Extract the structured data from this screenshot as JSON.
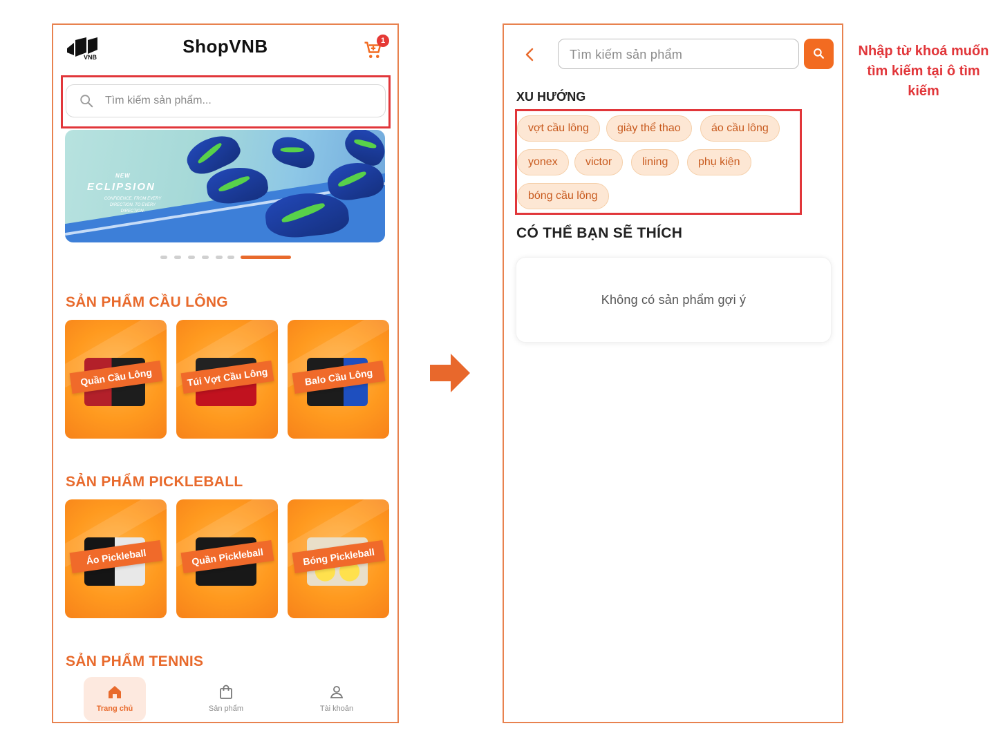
{
  "left_screen": {
    "app_title": "ShopVNB",
    "logo_text": "VNB",
    "cart_count": "1",
    "search_placeholder": "Tìm kiếm sản phẩm...",
    "banner": {
      "small_text": "NEW",
      "brand": "ECLIPSION",
      "tagline": "CONFIDENCE. FROM EVERY DIRECTION. TO EVERY DIRECTION.",
      "slide_count": 7,
      "active_slide": 7
    },
    "sections": [
      {
        "title": "SẢN PHẨM CẦU LÔNG",
        "cards": [
          "Quần Cầu Lông",
          "Túi Vợt Cầu Lông",
          "Balo Cầu Lông"
        ]
      },
      {
        "title": "SẢN PHẨM PICKLEBALL",
        "cards": [
          "Áo Pickleball",
          "Quần Pickleball",
          "Bóng Pickleball"
        ]
      },
      {
        "title": "SẢN PHẨM TENNIS",
        "cards": []
      }
    ],
    "bottom_nav": [
      {
        "label": "Trang chủ",
        "icon": "home-icon",
        "active": true
      },
      {
        "label": "Sản phẩm",
        "icon": "shopping-bag-icon",
        "active": false
      },
      {
        "label": "Tài khoản",
        "icon": "user-icon",
        "active": false
      }
    ]
  },
  "right_screen": {
    "search_placeholder": "Tìm kiếm sản phẩm",
    "trend_heading": "XU HƯỚNG",
    "trend_tags": [
      "vợt cầu lông",
      "giày thể thao",
      "áo cầu lông",
      "yonex",
      "victor",
      "lining",
      "phụ kiện",
      "bóng cầu lông"
    ],
    "suggest_heading": "CÓ THỂ BẠN SẼ THÍCH",
    "empty_message": "Không có sản phẩm gợi ý"
  },
  "annotation": {
    "text": "Nhập từ khoá muốn tìm kiếm tại ô tìm kiếm"
  },
  "colors": {
    "accent": "#e86a2c",
    "highlight_box": "#e1363a",
    "tag_bg": "#fde7d4",
    "search_button": "#f26b21"
  }
}
